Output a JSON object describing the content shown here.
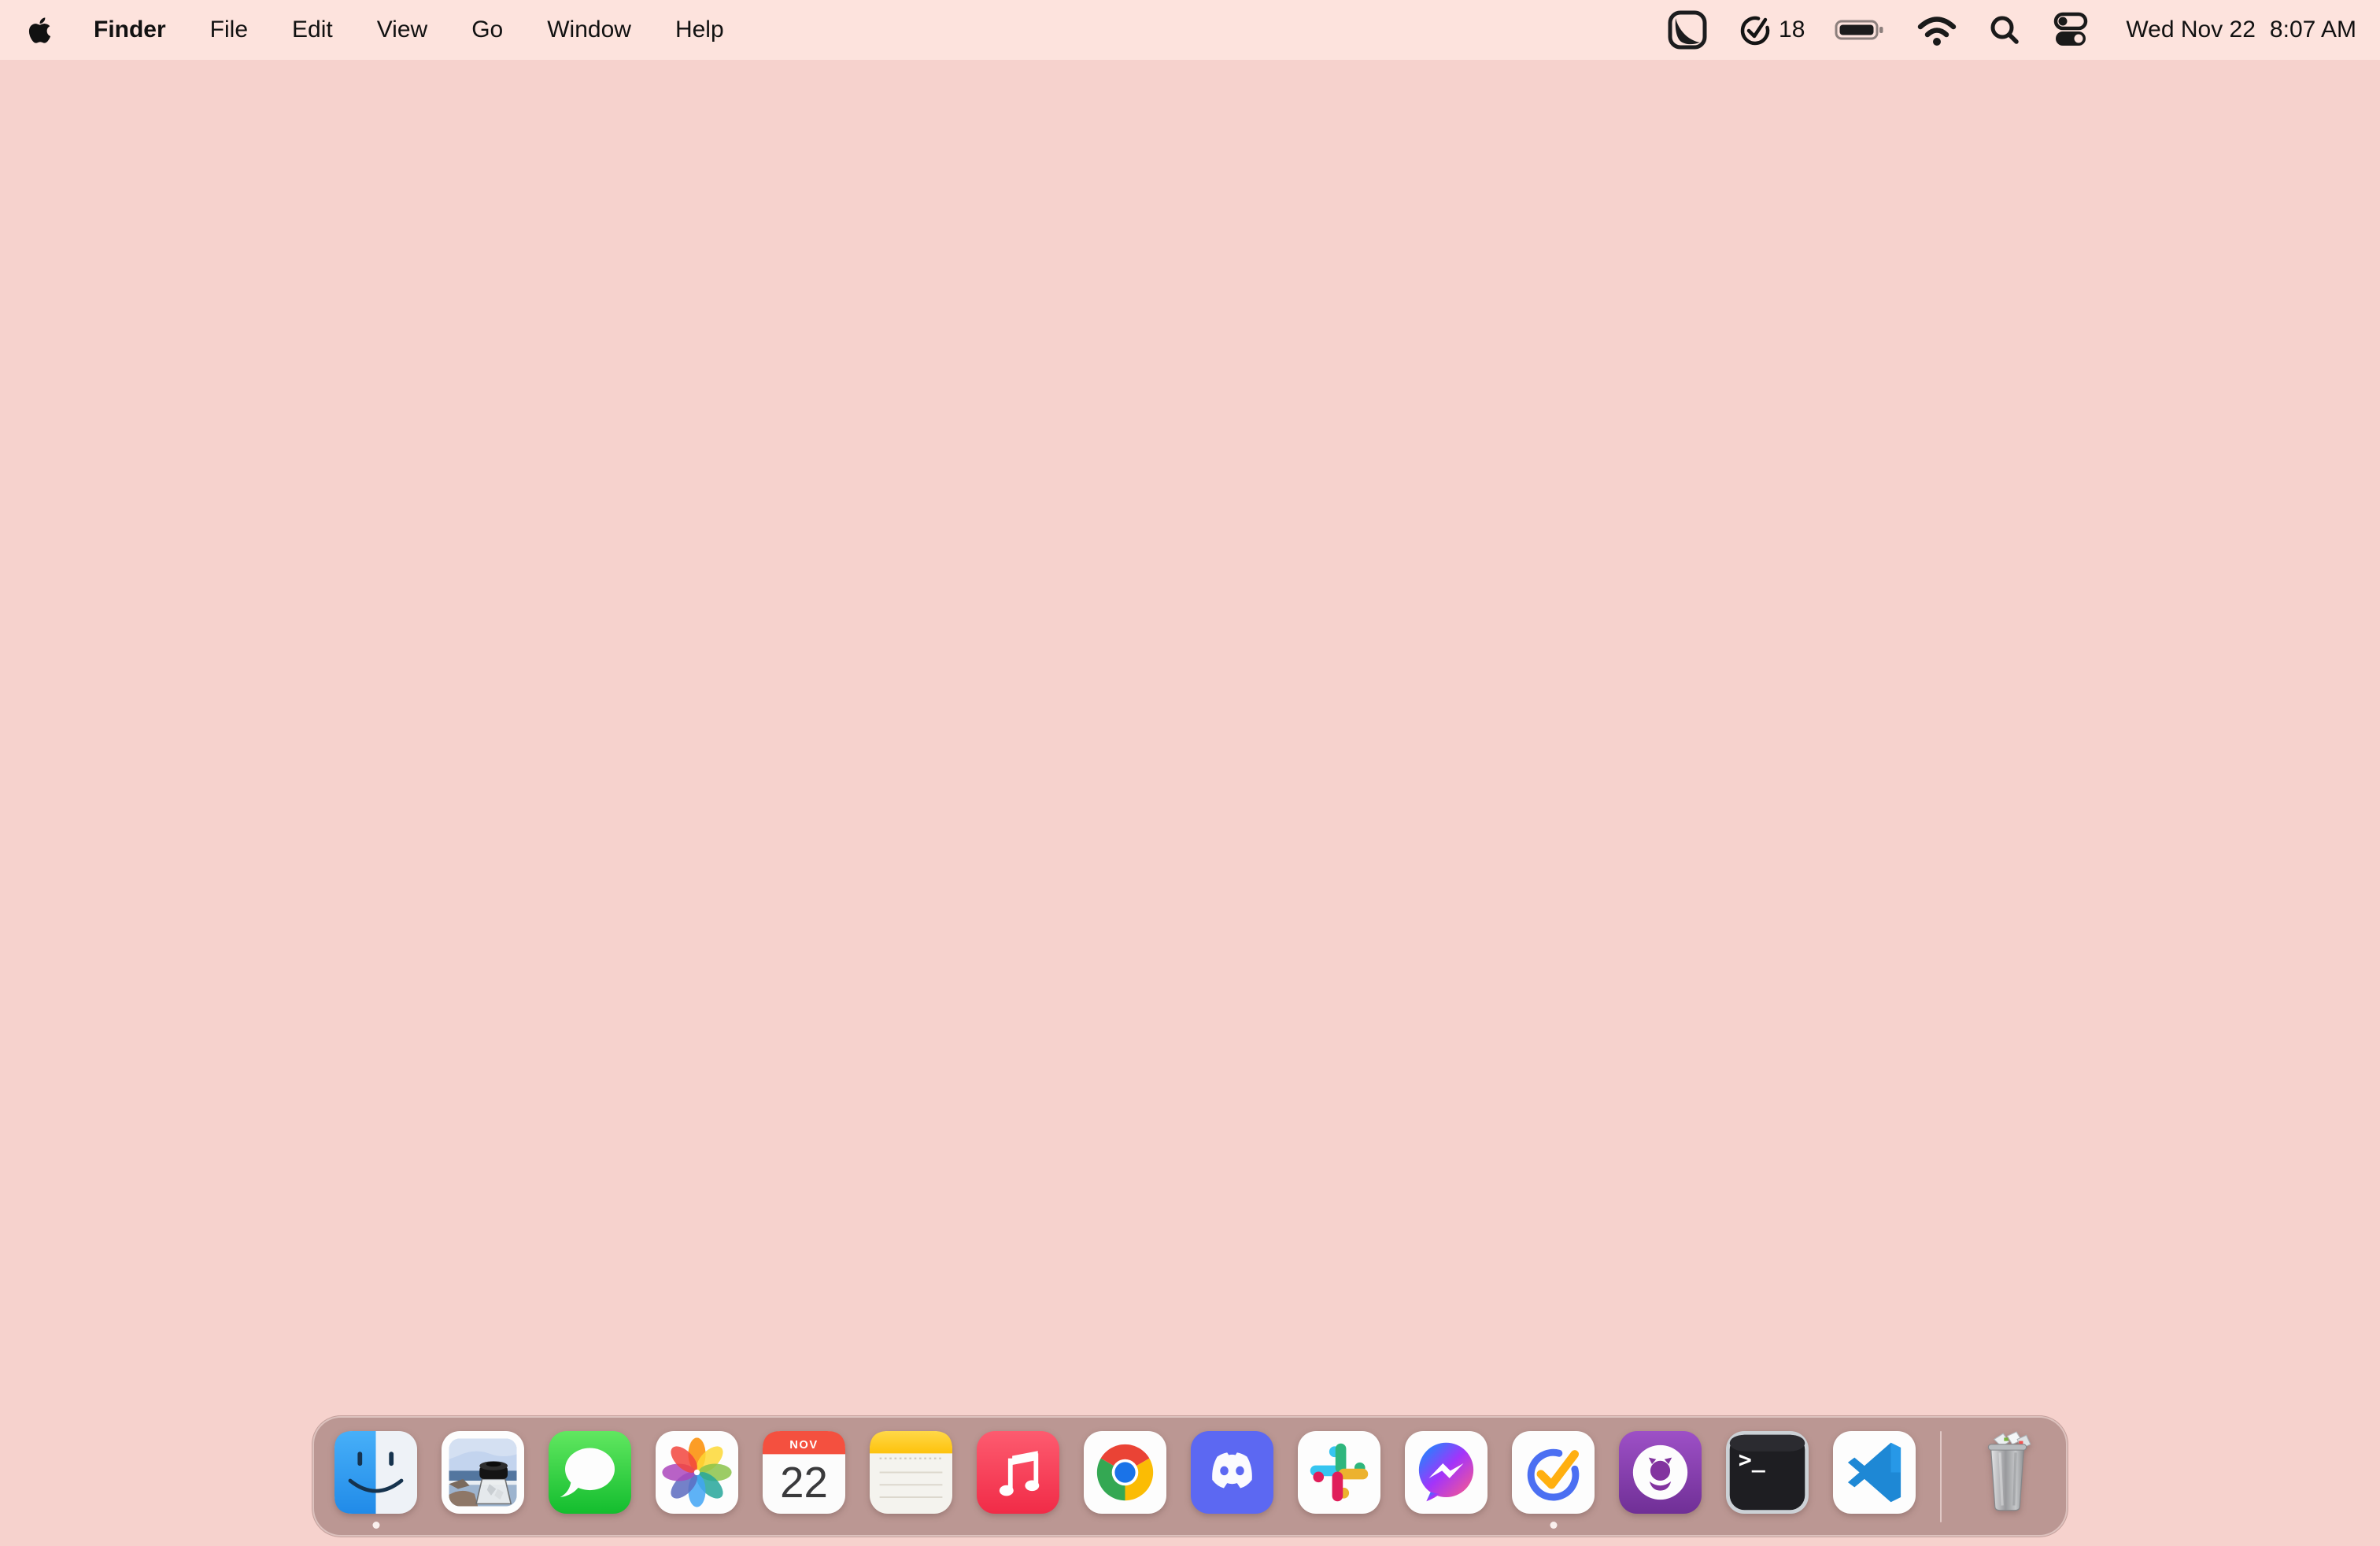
{
  "colors": {
    "desktop_bg": "#f6d2cd",
    "menubar_bg": "#fde3dd",
    "dock_bg": "#bb9793",
    "text": "#111111",
    "finder_blue": "#2aa2f5",
    "ticktick_blue": "#4b6ff2",
    "ticktick_orange": "#ffaf0f",
    "discord_blurple": "#5c68f2"
  },
  "menubar": {
    "active_app": "Finder",
    "menus": [
      "File",
      "Edit",
      "View",
      "Go",
      "Window",
      "Help"
    ],
    "status": {
      "ticktick_badge": "18",
      "date": "Wed Nov 22",
      "time": "8:07 AM"
    }
  },
  "dock": {
    "apps": [
      {
        "name": "Finder",
        "running": true
      },
      {
        "name": "Preview",
        "running": false
      },
      {
        "name": "Messages",
        "running": false
      },
      {
        "name": "Photos",
        "running": false
      },
      {
        "name": "Calendar",
        "running": false
      },
      {
        "name": "Notes",
        "running": false
      },
      {
        "name": "Music",
        "running": false
      },
      {
        "name": "Google Chrome",
        "running": false
      },
      {
        "name": "Discord",
        "running": false
      },
      {
        "name": "Slack",
        "running": false
      },
      {
        "name": "Messenger",
        "running": false
      },
      {
        "name": "TickTick",
        "running": true
      },
      {
        "name": "GitHub Desktop",
        "running": false
      },
      {
        "name": "Terminal",
        "running": false
      },
      {
        "name": "Visual Studio Code",
        "running": false
      },
      {
        "name": "Trash",
        "running": false
      }
    ],
    "calendar_icon": {
      "month": "NOV",
      "day": "22"
    },
    "terminal_glyph": ">_"
  }
}
